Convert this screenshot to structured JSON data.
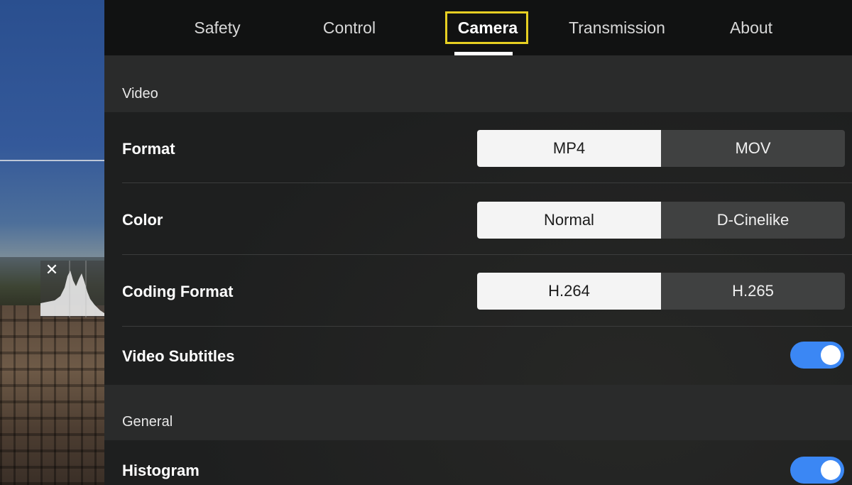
{
  "tabs": [
    {
      "label": "Safety"
    },
    {
      "label": "Control"
    },
    {
      "label": "Camera"
    },
    {
      "label": "Transmission"
    },
    {
      "label": "About"
    }
  ],
  "active_tab": "Camera",
  "sections": {
    "video": {
      "title": "Video",
      "format": {
        "label": "Format",
        "options": [
          "MP4",
          "MOV"
        ],
        "selected": "MP4"
      },
      "color": {
        "label": "Color",
        "options": [
          "Normal",
          "D-Cinelike"
        ],
        "selected": "Normal"
      },
      "coding_format": {
        "label": "Coding Format",
        "options": [
          "H.264",
          "H.265"
        ],
        "selected": "H.264"
      },
      "video_subtitles": {
        "label": "Video Subtitles",
        "enabled": true
      }
    },
    "general": {
      "title": "General",
      "histogram": {
        "label": "Histogram",
        "enabled": true
      }
    }
  },
  "histogram_overlay": {
    "close_icon": "close-icon",
    "close_glyph": "✕"
  },
  "colors": {
    "toggle_on": "#3b87f4",
    "highlight_box": "#e6cf22",
    "active_segment": "#f4f4f4",
    "inactive_segment": "#404141"
  }
}
